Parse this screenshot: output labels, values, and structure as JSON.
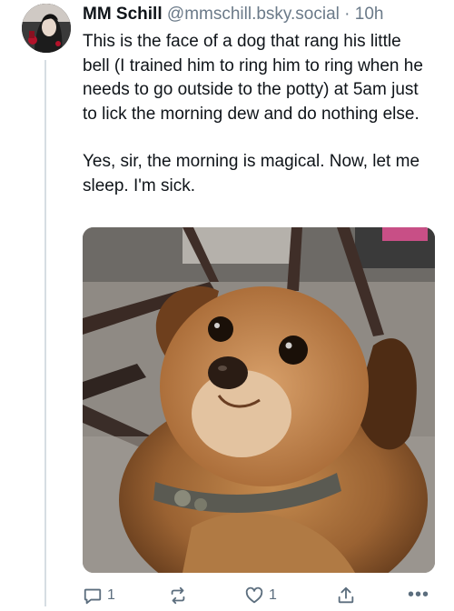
{
  "post": {
    "author": {
      "display_name": "MM Schill",
      "handle": "@mmschill.bsky.social",
      "separator": "·",
      "time": "10h"
    },
    "text_paragraphs": [
      "This is the face of a dog that rang his little bell (I trained him to ring him to ring when he needs to go outside to the potty) at 5am just to lick the morning dew and do nothing else.",
      "Yes, sir, the morning is magical. Now, let me sleep. I'm sick."
    ],
    "actions": {
      "reply_count": "1",
      "repost_count": "",
      "like_count": "1",
      "more_label": "•••"
    },
    "icons": {
      "reply": "speech-bubble-icon",
      "repost": "repost-arrows-icon",
      "like": "heart-icon",
      "share": "share-upload-icon",
      "more": "ellipsis-icon"
    }
  },
  "colors": {
    "text_primary": "#0f1419",
    "text_secondary": "#6b7a89",
    "icon": "#5c6e7e",
    "thread_line": "#d6dde3"
  }
}
